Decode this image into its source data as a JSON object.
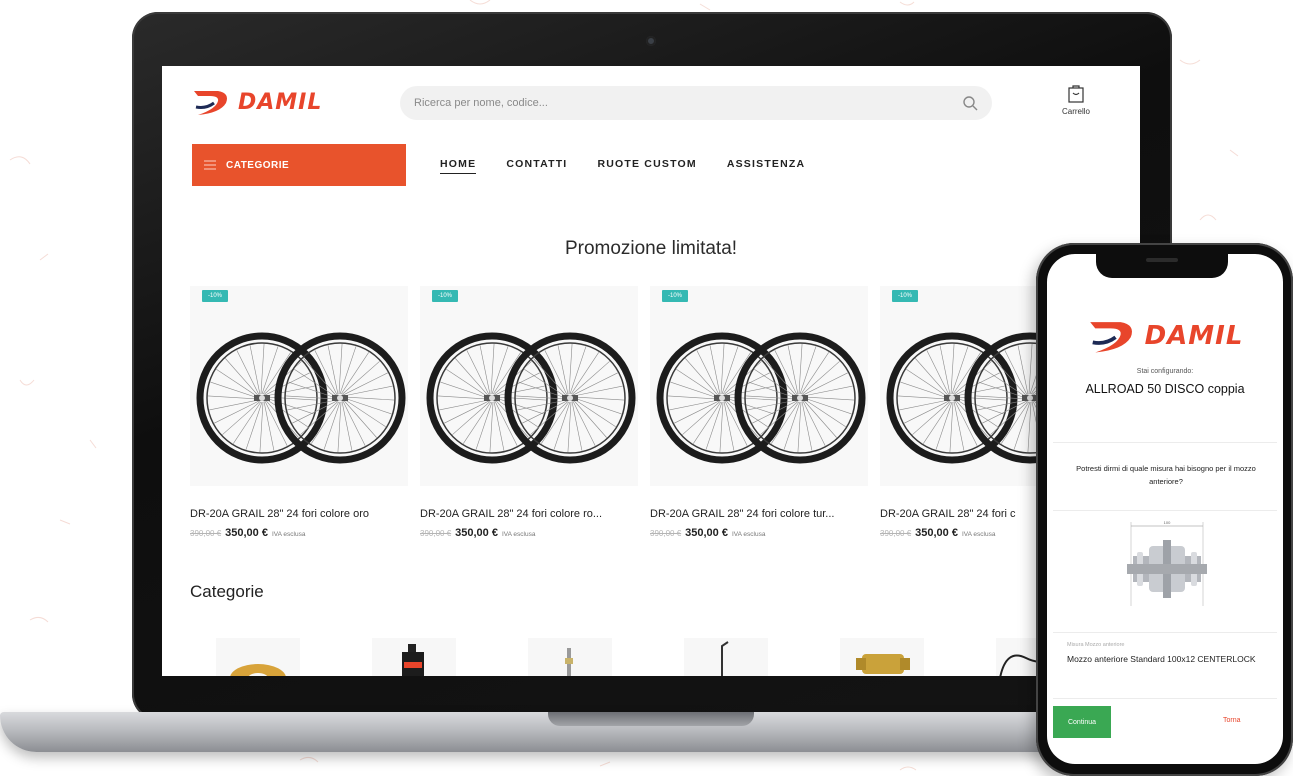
{
  "colors": {
    "brand": "#e8452b",
    "categorie_bg": "#e8532c",
    "badge": "#35b9b3",
    "continue": "#3aa853"
  },
  "laptop": {
    "logo": "DAMIL",
    "search": {
      "placeholder": "Ricerca per nome, codice..."
    },
    "cart_label": "Carrello",
    "categorie_label": "CATEGORIE",
    "nav": [
      "HOME",
      "CONTATTI",
      "RUOTE CUSTOM",
      "ASSISTENZA"
    ],
    "promo_title": "Promozione limitata!",
    "products": [
      {
        "badge": "-10%",
        "name": "DR-20A GRAIL 28\" 24 fori colore oro",
        "old_price": "390,00 €",
        "price": "350,00 €",
        "vat": "IVA esclusa"
      },
      {
        "badge": "-10%",
        "name": "DR-20A GRAIL 28\" 24 fori colore ro...",
        "old_price": "390,00 €",
        "price": "350,00 €",
        "vat": "IVA esclusa"
      },
      {
        "badge": "-10%",
        "name": "DR-20A GRAIL 28\" 24 fori colore tur...",
        "old_price": "390,00 €",
        "price": "350,00 €",
        "vat": "IVA esclusa"
      },
      {
        "badge": "-10%",
        "name": "DR-20A GRAIL 28\" 24 fori c",
        "old_price": "390,00 €",
        "price": "350,00 €",
        "vat": "IVA esclusa"
      }
    ],
    "categories_title": "Categorie"
  },
  "phone": {
    "logo": "DAMIL",
    "configuring_label": "Stai configurando:",
    "product": "ALLROAD 50 DISCO coppia",
    "question": "Potresti dirmi di quale misura hai bisogno per il mozzo anteriore?",
    "diagram_label": "100",
    "field_label": "Misura Mozzo anteriore",
    "field_value": "Mozzo anteriore Standard 100x12 CENTERLOCK",
    "continue_label": "Continua",
    "back_label": "Torna"
  }
}
